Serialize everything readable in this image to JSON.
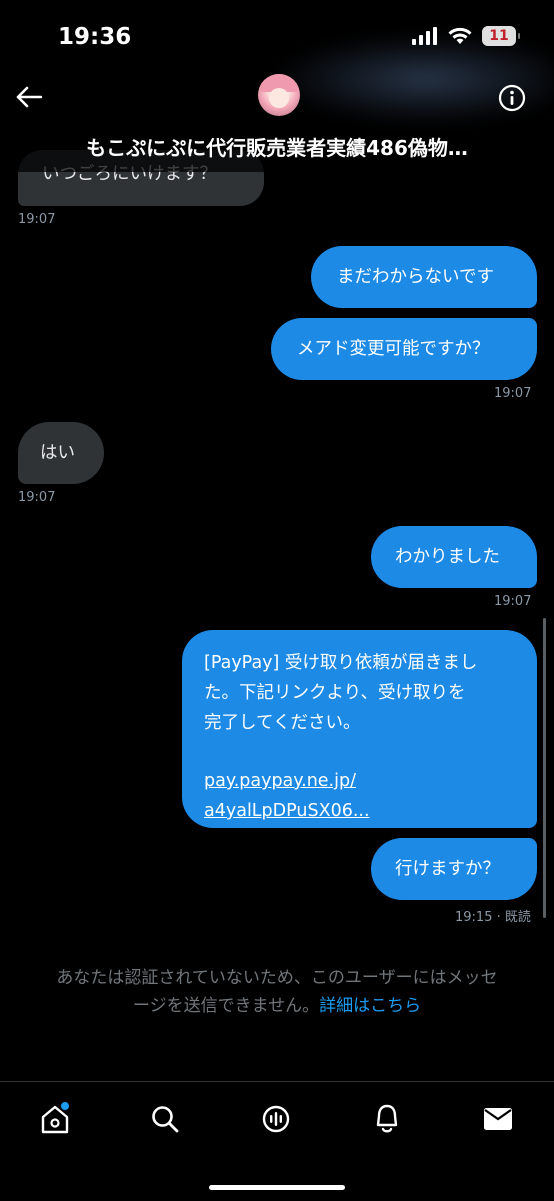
{
  "status_bar": {
    "time": "19:36",
    "battery": "11"
  },
  "header": {
    "title": "もこぷにぷに代行販売業者実績486偽物…"
  },
  "messages": [
    {
      "text": "いつごろにいけます？",
      "time": "19:07"
    },
    {
      "text": "まだわからないです"
    },
    {
      "text": "メアド変更可能ですか？",
      "time": "19:07"
    },
    {
      "text": "はい",
      "time": "19:07"
    },
    {
      "text": "わかりました",
      "time": "19:07"
    },
    {
      "line1": "[PayPay] 受け取り依頼が届きまし",
      "line2": "た。下記リンクより、受け取りを",
      "line3": "完了してください。",
      "link1": "pay.paypay.ne.jp/",
      "link2": "a4yalLpDPuSX06..."
    },
    {
      "text": "行けますか？",
      "time": "19:15 · 既読"
    }
  ],
  "notice": {
    "line1": "あなたは認証されていないため、このユーザーにはメッセ",
    "line2": "ージを送信できません。",
    "link": "詳細はこちら"
  },
  "tabs": [
    "home",
    "search",
    "spaces",
    "notifications",
    "messages"
  ],
  "colors": {
    "accent": "#1d9bf0",
    "outgoing_bubble": "#1d8ae6",
    "incoming_bubble": "#2f3336"
  }
}
